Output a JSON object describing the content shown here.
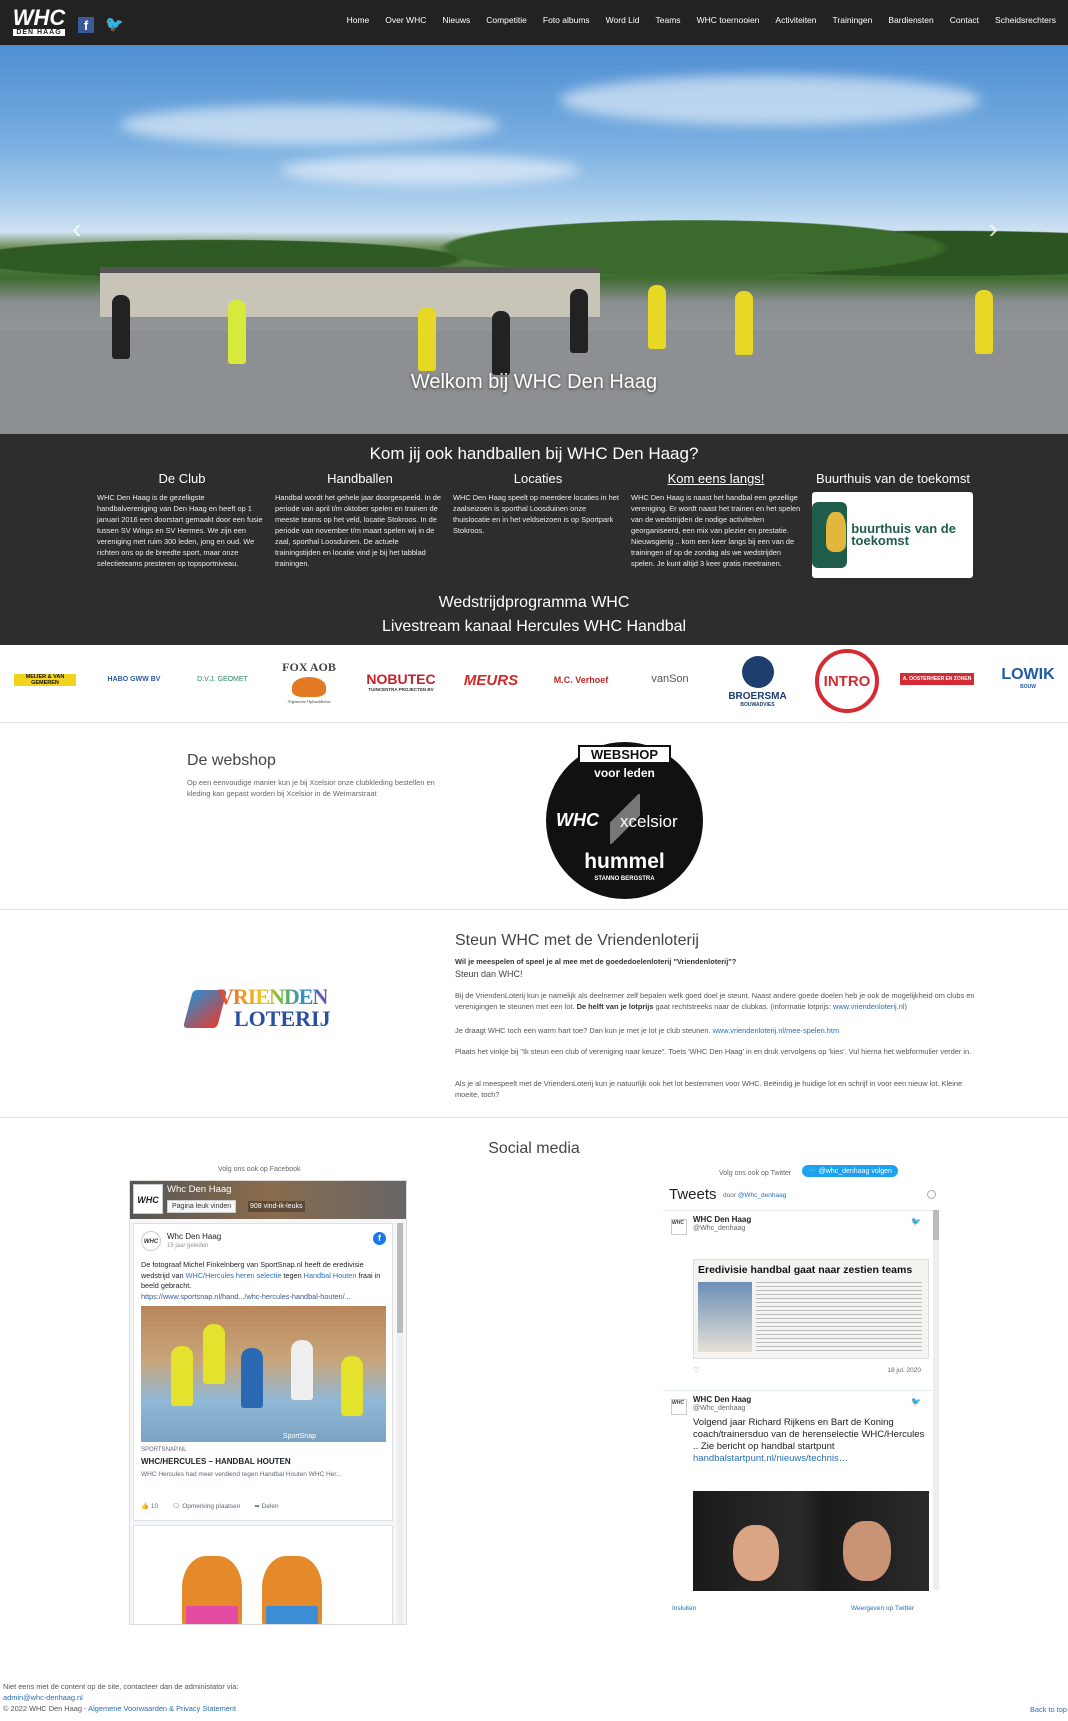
{
  "nav": {
    "logo_text": "WHC",
    "logo_sub": "DEN HAAG",
    "items": [
      "Home",
      "Over WHC",
      "Nieuws",
      "Competitie",
      "Foto albums",
      "Word Lid",
      "Teams",
      "WHC toernooien",
      "Activiteiten",
      "Trainingen",
      "Bardiensten",
      "Contact",
      "Scheidsrechters"
    ]
  },
  "hero": {
    "title": "Welkom bij WHC Den Haag"
  },
  "intro": {
    "heading": "Kom jij ook handballen bij WHC Den Haag?",
    "columns": [
      {
        "title": "De Club",
        "text": "WHC Den Haag is de gezelligste handbalvereniging van Den Haag en heeft op 1 januari 2016 een doorstart gemaakt door een fusie tussen SV Wings en SV Hermes. We zijn een vereniging met ruim 300 leden, jong en oud. We richten ons op de breedte sport, maar onze selectieteams presteren op topsportniveau."
      },
      {
        "title": "Handballen",
        "text": "Handbal wordt het gehele jaar doorgespeeld. In de periode van april t/m oktober spelen en trainen de meeste teams op het veld, locatie Stokroos. In de periode van november t/m maart spelen wij in de zaal, sporthal Loosduinen. De actuele trainingstijden en locatie vind je bij het tabblad trainingen."
      },
      {
        "title": "Locaties",
        "text": "WHC Den Haag speelt op meerdere locaties in het zaalseizoen is sporthal Loosduinen onze thuislocatie en in het veldseizoen is op Sportpark Stokroos."
      },
      {
        "title": "Kom eens langs!",
        "text": "WHC Den Haag is naast het handbal een gezellige vereniging. Er wordt naast het trainen en het spelen van de wedstrijden de nodige activiteiten georganiseerd, een mix van plezier en prestatie. Nieuwsgierig .. kom een keer langs bij een van de trainingen of op de zondag als we wedstrijden spelen. Je kunt altijd 3 keer gratis meetrainen."
      }
    ],
    "buurthuis_title": "Buurthuis van de toekomst",
    "buurthuis_logo": "buurthuis van de toekomst",
    "link1": "Wedstrijdprogramma WHC",
    "link2": "Livestream kanaal Hercules WHC Handbal"
  },
  "sponsors": [
    "MEIJER & VAN GEMEREN",
    "HABO GWW BV",
    "D.V.J. GEOMET",
    "FOX AOB",
    "NOBUTEC",
    "MEURS",
    "M.C. Verhoef",
    "vanSon",
    "BROERSMA",
    "INTRO",
    "A. OOSTERHEER EN ZONEN",
    "LOWIK"
  ],
  "sponsor_sub": {
    "FOX AOB": "Algemene Ophaaldienst",
    "NOBUTEC": "TUINCENTRA PROJECTEN BV",
    "BROERSMA": "BOUWADVIES",
    "LOWIK": "BOUW"
  },
  "webshop": {
    "title": "De webshop",
    "text": "Op een eenvoudige manier kun je bij Xcelsior onze clubkleding bestellen en kleding kan gepast worden bij Xcelsior in de Weimarstraat",
    "badge_top": "WEBSHOP",
    "badge_sub": "voor leden",
    "badge_whc": "WHC",
    "badge_x": "xcelsior",
    "badge_hummel": "hummel",
    "badge_bottom": "STANNO BERGSTRA"
  },
  "loterij": {
    "logo_a": "VRIENDEN",
    "logo_b": "LOTERIJ",
    "title": "Steun WHC met de Vriendenloterij",
    "q": "Wil je meespelen of speel je al mee met de goededoelenloterij \"Vriendenloterij\"?",
    "sub": "Steun dan WHC!",
    "p1a": "Bij de VriendenLoterij kun je namelijk als deelnemer zelf bepalen welk goed doel je steunt. Naast andere goede doelen heb je ook de mogelijkheid om clubs en verenigingen te steunen met een lot.",
    "p1b": "De helft van je lotprijs",
    "p1c": "gaat rechtstreeks naar de clubkas. (informatie lotprijs:",
    "p1link": "www.vriendenloterij.nl",
    "p1d": ")",
    "p2": "Je draagt WHC toch een warm hart toe? Dan kun je met je lot je club steunen.",
    "p2link": "www.vriendenloterij.nl/mee-spelen.htm",
    "p3": "Plaats het vinkje bij \"Ik steun een club of vereniging naar keuze\". Toets 'WHC Den Haag' in en druk vervolgens op 'kies'. Vul hierna het webformulier verder in.",
    "p4": "Als je al meespeelt met de VriendenLoterij kun je natuurlijk ook het lot bestemmen voor WHC. Beëindig je huidige lot en schrijf in voor een nieuw lot. Kleine moeite, toch?"
  },
  "social": {
    "title": "Social media",
    "fb_follow": "Volg ons ook op Facebook",
    "fb_page": "Whc Den Haag",
    "fb_like": "Pagina leuk vinden",
    "fb_count": "908 vind-ik-leuks",
    "post_name": "Whc Den Haag",
    "post_time": "15 jaar geleden",
    "post_text_1": "De fotograaf Michel Finkelnberg van SportSnap.nl heeft de eredivisie wedstrijd van",
    "post_link_1": "WHC/Hercules heren selectie",
    "post_text_2": "tegen",
    "post_link_2": "Handbal Houten",
    "post_text_3": "fraai in beeld gebracht.",
    "post_url": "https://www.sportsnap.nl/hand.../whc-hercules-handbal-houten/...",
    "img_wm": "SportSnap",
    "site": "SPORTSNAP.NL",
    "headline": "WHC/HERCULES – HANDBAL HOUTEN",
    "desc": "WHC Hercules had meer verdiend tegen Handbal Houten WHC Her...",
    "likes": "10",
    "comment": "Opmerking plaatsen",
    "share": "Delen",
    "tw_follow": "Volg ons ook op Twitter",
    "tw_button": "@whc_denhaag volgen",
    "tw_heading": "Tweets",
    "tw_by": "door",
    "tw_by_handle": "@Whc_denhaag",
    "t1_name": "WHC Den Haag",
    "t1_handle": "@Whc_denhaag",
    "t1_headline": "Eredivisie handbal gaat naar zestien teams",
    "t1_date": "18 jul. 2020",
    "t2_name": "WHC Den Haag",
    "t2_handle": "@Whc_denhaag",
    "t2_text": "Volgend jaar Richard Rijkens en Bart de Koning coach/trainersduo  van de herenselectie WHC/Hercules .. Zie bericht op handbal startpunt",
    "t2_link": "handbalstartpunt.nl/nieuws/technis…",
    "tw_embed": "Insluiten",
    "tw_view": "Weergeven op Twitter"
  },
  "footer": {
    "line1": "Niet eens met de content op de site, contacteer dan de administator via:",
    "email": "admin@whc-denhaag.nl",
    "copy": "© 2022 WHC Den Haag -",
    "privacy": "Algemene Voorwaarden & Privacy Statement",
    "top": "Back to top"
  }
}
